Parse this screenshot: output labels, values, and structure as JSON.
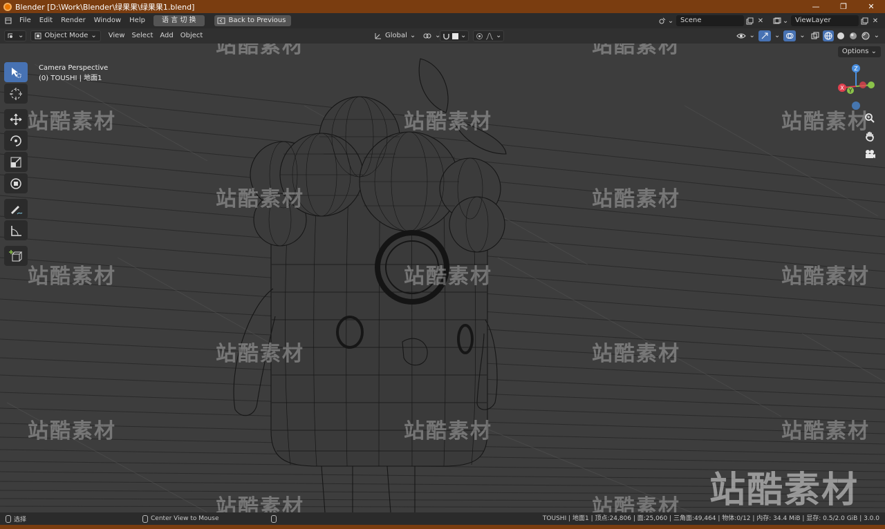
{
  "window": {
    "title": "Blender [D:\\Work\\Blender\\绿果果\\绿果果1.blend]",
    "controls": [
      "—",
      "❐",
      "✕"
    ]
  },
  "menubar": {
    "items": [
      "File",
      "Edit",
      "Render",
      "Window",
      "Help"
    ],
    "lang_button": "语 言 切 换",
    "back_button": "Back to Previous",
    "scene_field": "Scene",
    "viewlayer_field": "ViewLayer"
  },
  "header": {
    "mode": "Object Mode",
    "menus": [
      "View",
      "Select",
      "Add",
      "Object"
    ],
    "transform_orientation": "Global",
    "options_label": "Options"
  },
  "viewport": {
    "line1": "Camera Perspective",
    "line2": "(0) TOUSHI | 地面1",
    "watermark_text": "站酷素材",
    "axes": {
      "x": "X",
      "y": "Y",
      "z": "Z"
    }
  },
  "statusbar": {
    "left_action": "选择",
    "middle_action": "Center View to Mouse",
    "stats": "TOUSHI | 地面1 | 顶点:24,806 | 面:25,060 | 三角面:49,464 | 物体:0/12 | 内存: 34.4 MiB | 显存: 0.5/2.0 GiB | 3.0.0"
  },
  "colors": {
    "accent": "#4772b3",
    "titlebar": "#7a3d10",
    "viewport_bg": "#3d3d3d",
    "axis_x": "#e0414f",
    "axis_y": "#8bc34a",
    "axis_z": "#4a8fe0"
  }
}
